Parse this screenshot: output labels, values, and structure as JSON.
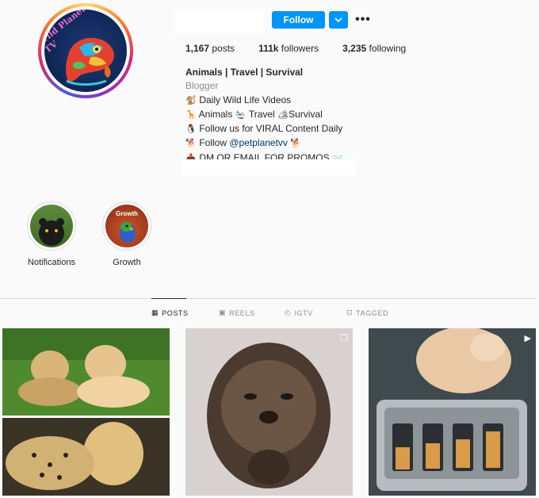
{
  "profile": {
    "avatar_text": "Wild Planet TV"
  },
  "header": {
    "follow_label": "Follow",
    "dropdown_icon": "chevron-down-icon",
    "more_icon": "more-dots-icon",
    "more_glyph": "•••"
  },
  "stats": {
    "posts_count": "1,167",
    "posts_label": "posts",
    "followers_count": "111k",
    "followers_label": "followers",
    "following_count": "3,235",
    "following_label": "following"
  },
  "bio": {
    "name": "Animals | Travel | Survival",
    "category": "Blogger",
    "line1": "Daily Wild Life Videos",
    "line2_a": "Animals",
    "line2_b": "Travel",
    "line2_c": "Survival",
    "line3": "Follow us for VIRAL Content Daily",
    "line4_prefix": "Follow",
    "line4_handle": "@petplanetvv",
    "line5": "DM OR EMAIL FOR PROMOS"
  },
  "highlights": [
    {
      "label": "Notifications"
    },
    {
      "label": "Growth",
      "cover_text": "Growth"
    }
  ],
  "tabs": [
    {
      "label": "POSTS",
      "icon": "grid-icon",
      "active": true
    },
    {
      "label": "REELS",
      "icon": "reels-icon",
      "active": false
    },
    {
      "label": "IGTV",
      "icon": "igtv-icon",
      "active": false
    },
    {
      "label": "TAGGED",
      "icon": "tagged-icon",
      "active": false
    }
  ],
  "posts": [
    {
      "subject": "cheetah cub and puppy",
      "badge": ""
    },
    {
      "subject": "otter",
      "badge": "carousel-icon"
    },
    {
      "subject": "cat and toaster",
      "badge": "reels-icon"
    }
  ],
  "colors": {
    "accent": "#0095f6",
    "link": "#00376b",
    "muted": "#8e8e8e",
    "text": "#262626"
  }
}
